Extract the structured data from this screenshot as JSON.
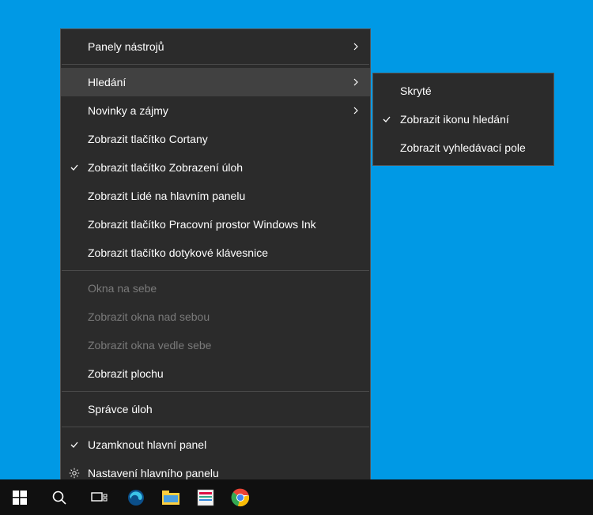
{
  "mainMenu": {
    "items": [
      {
        "label": "Panely nástrojů",
        "hasSubmenu": true
      },
      {
        "label": "Hledání",
        "hasSubmenu": true,
        "highlighted": true
      },
      {
        "label": "Novinky a zájmy",
        "hasSubmenu": true
      },
      {
        "label": "Zobrazit tlačítko Cortany"
      },
      {
        "label": "Zobrazit tlačítko Zobrazení úloh",
        "checked": true
      },
      {
        "label": "Zobrazit Lidé na hlavním panelu"
      },
      {
        "label": "Zobrazit tlačítko Pracovní prostor Windows Ink"
      },
      {
        "label": "Zobrazit tlačítko dotykové klávesnice"
      },
      {
        "label": "Okna na sebe",
        "disabled": true
      },
      {
        "label": "Zobrazit okna nad sebou",
        "disabled": true
      },
      {
        "label": "Zobrazit okna vedle sebe",
        "disabled": true
      },
      {
        "label": "Zobrazit plochu"
      },
      {
        "label": "Správce úloh"
      },
      {
        "label": "Uzamknout hlavní panel",
        "checked": true
      },
      {
        "label": "Nastavení hlavního panelu",
        "gear": true
      }
    ]
  },
  "submenu": {
    "items": [
      {
        "label": "Skryté"
      },
      {
        "label": "Zobrazit ikonu hledání",
        "checked": true
      },
      {
        "label": "Zobrazit vyhledávací pole"
      }
    ]
  },
  "taskbar": {
    "start": "start-icon",
    "search": "search-icon",
    "taskview": "taskview-icon",
    "apps": [
      "edge-icon",
      "explorer-icon",
      "app-icon",
      "chrome-icon"
    ]
  }
}
